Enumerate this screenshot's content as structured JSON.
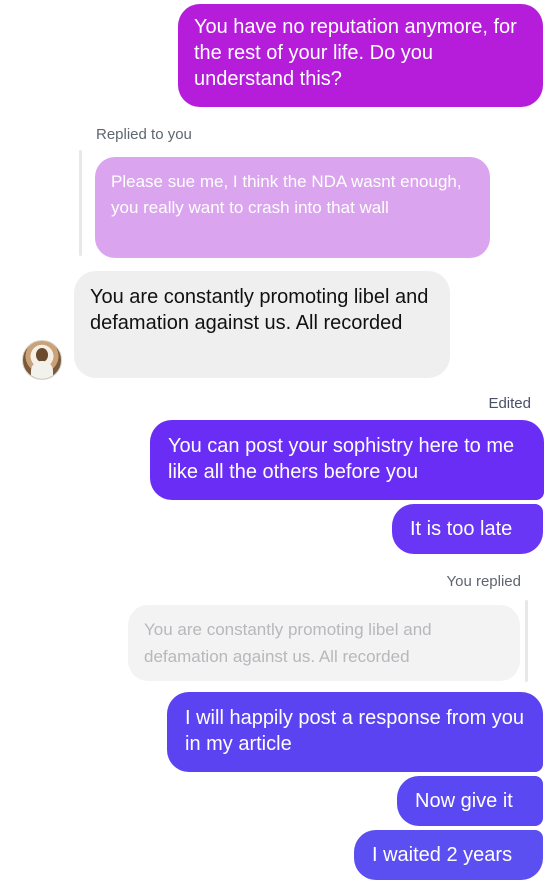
{
  "colors": {
    "outgoing_magenta": "#b51ddb",
    "outgoing_violet": "#6a2df5",
    "outgoing_indigo": "#5b43f2",
    "incoming_bg": "#efefef",
    "quoted_pink_bg": "#d9a0ee",
    "quoted_gray_bg": "#f3f3f3"
  },
  "messages": [
    {
      "text": "You have no reputation anymore, for the rest of your life. Do you understand this?",
      "direction": "outgoing"
    },
    {
      "label": "Replied to you"
    },
    {
      "text": "Please sue me, I think the NDA wasnt enough, you really want to crash into that wall",
      "type": "quoted"
    },
    {
      "text": "You are constantly promoting libel and defamation against us. All recorded",
      "direction": "incoming"
    },
    {
      "label": "Edited"
    },
    {
      "text": "You can post your sophistry here to me like all the others before you",
      "direction": "outgoing"
    },
    {
      "text": "It is too late",
      "direction": "outgoing"
    },
    {
      "label": "You replied"
    },
    {
      "text": "You are constantly promoting libel and defamation against us. All recorded",
      "type": "quoted"
    },
    {
      "text": "I will happily post a response from you in my article",
      "direction": "outgoing"
    },
    {
      "text": "Now give it",
      "direction": "outgoing"
    },
    {
      "text": "I waited 2 years",
      "direction": "outgoing"
    }
  ],
  "avatar_icon": "user-avatar-icon"
}
